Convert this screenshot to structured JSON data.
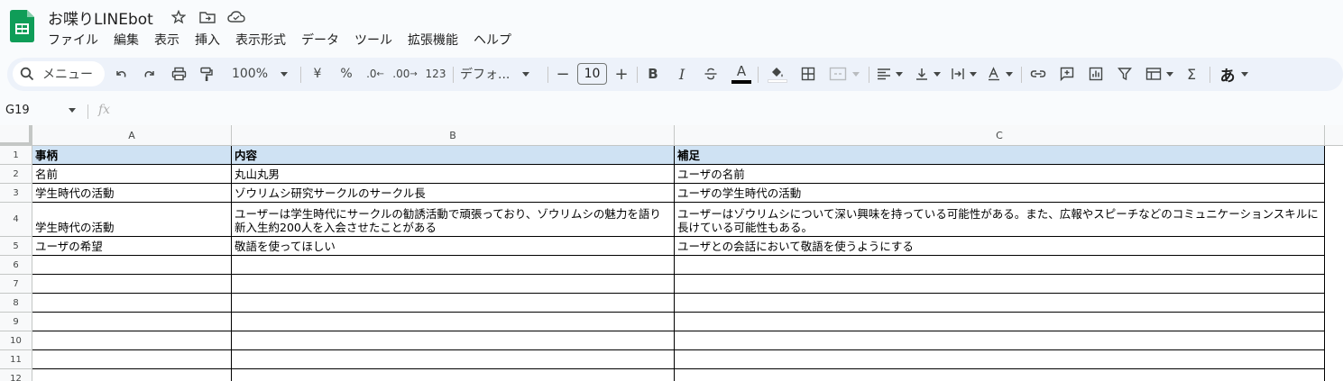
{
  "doc": {
    "title": "お喋りLINEbot"
  },
  "menu": [
    "ファイル",
    "編集",
    "表示",
    "挿入",
    "表示形式",
    "データ",
    "ツール",
    "拡張機能",
    "ヘルプ"
  ],
  "toolbar": {
    "search_placeholder": "メニュー",
    "zoom": "100%",
    "currency": "¥",
    "percent": "%",
    "decrease_decimal": ".0",
    "increase_decimal": ".00",
    "number_format": "123",
    "font": "デフォ...",
    "font_size": "10",
    "bold": "B",
    "italic": "I",
    "text_color": "A",
    "input_tools": "あ"
  },
  "formula_bar": {
    "name_box": "G19",
    "fx": "fx"
  },
  "columns": [
    "A",
    "B",
    "C"
  ],
  "rows": [
    "1",
    "2",
    "3",
    "4",
    "5",
    "6",
    "7",
    "8",
    "9",
    "10",
    "11",
    "12"
  ],
  "table": {
    "r1": [
      "事柄",
      "内容",
      "補足"
    ],
    "r2": [
      "名前",
      "丸山丸男",
      "ユーザの名前"
    ],
    "r3": [
      "学生時代の活動",
      "ゾウリムシ研究サークルのサークル長",
      "ユーザの学生時代の活動"
    ],
    "r4": [
      "学生時代の活動",
      "ユーザーは学生時代にサークルの勧誘活動で頑張っており、ゾウリムシの魅力を語り新入生約200人を入会させたことがある",
      "ユーザーはゾウリムシについて深い興味を持っている可能性がある。また、広報やスピーチなどのコミュニケーションスキルに長けている可能性もある。"
    ],
    "r5": [
      "ユーザの希望",
      "敬語を使ってほしい",
      "ユーザとの会話において敬語を使うようにする"
    ]
  },
  "colors": {
    "header_fill": "#cfe2f3",
    "accent": "#0f9d58"
  }
}
